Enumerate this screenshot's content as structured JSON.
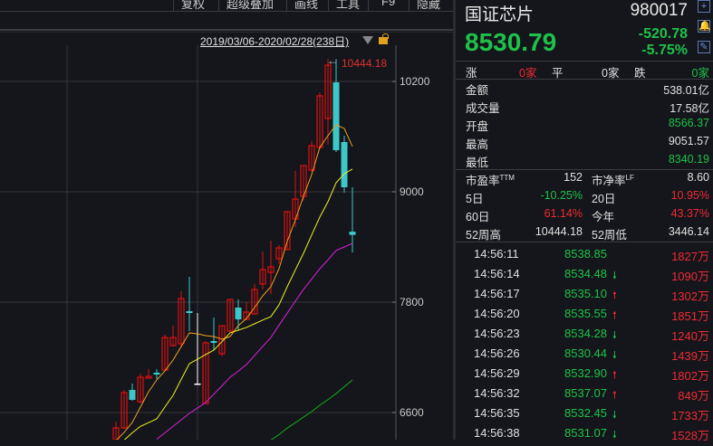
{
  "toolbar": {
    "items": [
      "复权",
      "超级叠加",
      "画线",
      "工具",
      "F9",
      "隐藏"
    ]
  },
  "chart": {
    "date_range": "2019/03/06-2020/02/28(238日)",
    "peak_label": "10444.18",
    "peak_arrow": "←",
    "y_ticks": [
      "10200",
      "9000",
      "7800",
      "6600"
    ],
    "colors": {
      "up": "#e01010",
      "down": "#3cc8c8",
      "doji": "#ffffff",
      "ma5": "#f0a020",
      "ma10": "#f0f020",
      "ma20": "#e020e0",
      "ma60": "#10b010"
    }
  },
  "chart_data": {
    "type": "candlestick",
    "ylim": [
      6200,
      10700
    ],
    "y_ticks": [
      10200,
      9000,
      7800,
      6600
    ],
    "ohlc": [
      [
        6305,
        6502,
        6290,
        6433
      ],
      [
        6433,
        6846,
        6420,
        6816
      ],
      [
        6846,
        6915,
        6728,
        6738
      ],
      [
        6718,
        7023,
        6700,
        6984
      ],
      [
        6974,
        7072,
        6974,
        6993
      ],
      [
        7033,
        7072,
        6964,
        7013
      ],
      [
        7062,
        7446,
        7062,
        7416
      ],
      [
        7328,
        7544,
        7318,
        7416
      ],
      [
        7348,
        7918,
        7308,
        7839
      ],
      [
        7702,
        8075,
        7485,
        7682
      ],
      [
        6915,
        7682,
        6915,
        6915
      ],
      [
        6698,
        7377,
        6698,
        7357
      ],
      [
        7377,
        7633,
        7279,
        7357
      ],
      [
        7239,
        7544,
        7210,
        7544
      ],
      [
        7485,
        7829,
        7485,
        7829
      ],
      [
        7741,
        7829,
        7495,
        7613
      ],
      [
        7613,
        7800,
        7613,
        7692
      ],
      [
        7672,
        8000,
        7672,
        7938
      ],
      [
        7997,
        8351,
        7938,
        8154
      ],
      [
        8125,
        8469,
        7889,
        8184
      ],
      [
        8272,
        8420,
        8213,
        8390
      ],
      [
        8371,
        8784,
        8371,
        8784
      ],
      [
        8705,
        9226,
        8616,
        8921
      ],
      [
        8951,
        9285,
        8900,
        9285
      ],
      [
        9236,
        9551,
        9216,
        9502
      ],
      [
        9482,
        10082,
        9462,
        10043
      ],
      [
        9797,
        10444,
        9511,
        10377
      ],
      [
        10190,
        10444,
        9433,
        9452
      ],
      [
        9541,
        9610,
        8990,
        9049
      ],
      [
        8567,
        9051,
        8340,
        8531
      ]
    ],
    "ma5": [
      6295,
      6384,
      6492,
      6659,
      6826,
      6954,
      7052,
      7170,
      7318,
      7466,
      7456,
      7436,
      7426,
      7397,
      7426,
      7544,
      7623,
      7741,
      7869,
      7967,
      8164,
      8459,
      8695,
      8951,
      9187,
      9482,
      9610,
      9728,
      9689,
      9492
    ],
    "ma10": [
      null,
      6300,
      6380,
      6450,
      6490,
      6531,
      6660,
      6787,
      6960,
      7131,
      7180,
      7230,
      7279,
      7370,
      7466,
      7495,
      7525,
      7565,
      7605,
      7643,
      7771,
      7967,
      8150,
      8331,
      8530,
      8725,
      8892,
      9098,
      9197,
      9246
    ],
    "ma20": [
      null,
      null,
      null,
      null,
      null,
      6310,
      6380,
      6450,
      6520,
      6590,
      6650,
      6708,
      6800,
      6890,
      6984,
      7050,
      7121,
      7220,
      7320,
      7416,
      7550,
      7680,
      7810,
      7938,
      8050,
      8164,
      8260,
      8361,
      8400,
      8439
    ],
    "ma60": [
      null,
      null,
      null,
      null,
      null,
      null,
      null,
      null,
      null,
      null,
      null,
      null,
      null,
      null,
      null,
      null,
      null,
      null,
      null,
      6300,
      6360,
      6430,
      6490,
      6550,
      6610,
      6680,
      6740,
      6806,
      6880,
      6954
    ]
  },
  "quote": {
    "name": "国证芯片",
    "code": "980017",
    "price": "8530.79",
    "change": "-520.78",
    "change_pct": "-5.75%"
  },
  "breadth": {
    "up_label": "涨",
    "up": "0家",
    "flat_label": "平",
    "flat": "0家",
    "down_label": "跌",
    "down": "0家"
  },
  "stats": [
    {
      "label": "金额",
      "value": "538.01亿",
      "color": "w"
    },
    {
      "label": "成交量",
      "value": "17.58亿",
      "color": "w"
    },
    {
      "label": "开盘",
      "value": "8566.37",
      "color": "g"
    },
    {
      "label": "最高",
      "value": "9051.57",
      "color": "w"
    },
    {
      "label": "最低",
      "value": "8340.19",
      "color": "g"
    }
  ],
  "metrics": [
    {
      "l1": "市盈率",
      "s1": "TTM",
      "v1": "152",
      "c1": "w",
      "l2": "市净率",
      "s2": "LF",
      "v2": "8.60",
      "c2": "w"
    },
    {
      "l1": "5日",
      "s1": "",
      "v1": "-10.25%",
      "c1": "g",
      "l2": "20日",
      "s2": "",
      "v2": "10.95%",
      "c2": "red"
    },
    {
      "l1": "60日",
      "s1": "",
      "v1": "61.14%",
      "c1": "red",
      "l2": "今年",
      "s2": "",
      "v2": "43.37%",
      "c2": "red"
    },
    {
      "l1": "52周高",
      "s1": "",
      "v1": "10444.18",
      "c1": "w",
      "l2": "52周低",
      "s2": "",
      "v2": "3446.14",
      "c2": "w"
    }
  ],
  "ticks": [
    {
      "time": "14:56:11",
      "price": "8538.85",
      "dir": "",
      "vol": "1827万"
    },
    {
      "time": "14:56:14",
      "price": "8534.48",
      "dir": "down",
      "vol": "1090万"
    },
    {
      "time": "14:56:17",
      "price": "8535.10",
      "dir": "up",
      "vol": "1302万"
    },
    {
      "time": "14:56:20",
      "price": "8535.55",
      "dir": "up",
      "vol": "1851万"
    },
    {
      "time": "14:56:23",
      "price": "8534.28",
      "dir": "down",
      "vol": "1240万"
    },
    {
      "time": "14:56:26",
      "price": "8530.44",
      "dir": "down",
      "vol": "1439万"
    },
    {
      "time": "14:56:29",
      "price": "8532.90",
      "dir": "up",
      "vol": "1802万"
    },
    {
      "time": "14:56:32",
      "price": "8537.07",
      "dir": "up",
      "vol": "849万"
    },
    {
      "time": "14:56:35",
      "price": "8532.45",
      "dir": "down",
      "vol": "1733万"
    },
    {
      "time": "14:56:38",
      "price": "8531.07",
      "dir": "down",
      "vol": "1528万"
    }
  ]
}
